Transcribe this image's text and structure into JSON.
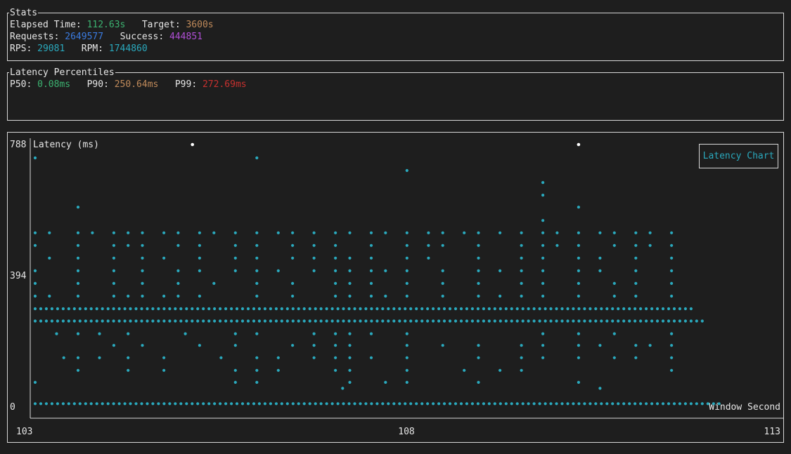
{
  "stats": {
    "title": "Stats",
    "elapsed_label": "Elapsed Time:",
    "elapsed_value": "112.63s",
    "target_label": "Target:",
    "target_value": "3600s",
    "requests_label": "Requests:",
    "requests_value": "2649577",
    "success_label": "Success:",
    "success_value": "444851",
    "rps_label": "RPS:",
    "rps_value": "29081",
    "rpm_label": "RPM:",
    "rpm_value": "1744860"
  },
  "latency": {
    "title": "Latency Percentiles",
    "p50_label": "P50:",
    "p50_value": "0.08ms",
    "p90_label": "P90:",
    "p90_value": "250.64ms",
    "p99_label": "P99:",
    "p99_value": "272.69ms"
  },
  "colors": {
    "point": "#2aa9bd",
    "point_highlight": "#ffffff",
    "axis": "#d8d8d8"
  },
  "chart_data": {
    "type": "scatter",
    "title": "Latency (ms)",
    "legend": "Latency Chart",
    "legend_position": "top-right",
    "xlabel": "Window Second",
    "ylabel": "",
    "y_ticks": [
      "788",
      "394",
      "0"
    ],
    "x_ticks": [
      "103",
      "108",
      "113"
    ],
    "xlim": [
      103,
      113
    ],
    "ylim": [
      0,
      788
    ],
    "dense_rows": [
      {
        "y": 10,
        "x_start": 103.0,
        "x_end": 112.6
      },
      {
        "y": 295,
        "x_start": 103.0,
        "x_end": 112.2
      },
      {
        "y": 258,
        "x_start": 103.0,
        "x_end": 112.4
      }
    ],
    "series": [
      {
        "name": "Latency Chart",
        "points": [
          [
            103.0,
            748
          ],
          [
            106.1,
            748
          ],
          [
            108.2,
            710
          ],
          [
            110.1,
            674
          ],
          [
            110.1,
            636
          ],
          [
            107.3,
            56
          ],
          [
            110.9,
            56
          ],
          [
            103.6,
            600
          ],
          [
            110.1,
            560
          ],
          [
            110.6,
            600
          ],
          [
            103.0,
            523
          ],
          [
            103.2,
            523
          ],
          [
            103.6,
            523
          ],
          [
            103.8,
            523
          ],
          [
            104.1,
            523
          ],
          [
            104.3,
            523
          ],
          [
            104.5,
            523
          ],
          [
            104.8,
            523
          ],
          [
            105.0,
            523
          ],
          [
            105.3,
            523
          ],
          [
            105.5,
            523
          ],
          [
            105.8,
            523
          ],
          [
            106.1,
            523
          ],
          [
            106.4,
            523
          ],
          [
            106.6,
            523
          ],
          [
            106.9,
            523
          ],
          [
            107.2,
            523
          ],
          [
            107.4,
            523
          ],
          [
            107.7,
            523
          ],
          [
            107.9,
            523
          ],
          [
            108.2,
            523
          ],
          [
            108.5,
            523
          ],
          [
            108.7,
            523
          ],
          [
            109.0,
            523
          ],
          [
            109.2,
            523
          ],
          [
            109.5,
            523
          ],
          [
            109.8,
            523
          ],
          [
            110.1,
            523
          ],
          [
            110.3,
            523
          ],
          [
            110.6,
            523
          ],
          [
            110.9,
            523
          ],
          [
            111.1,
            523
          ],
          [
            111.4,
            523
          ],
          [
            111.6,
            523
          ],
          [
            111.9,
            523
          ],
          [
            103.0,
            485
          ],
          [
            103.6,
            485
          ],
          [
            104.1,
            485
          ],
          [
            104.3,
            485
          ],
          [
            104.5,
            485
          ],
          [
            105.0,
            485
          ],
          [
            105.3,
            485
          ],
          [
            105.8,
            485
          ],
          [
            106.1,
            485
          ],
          [
            106.6,
            485
          ],
          [
            106.9,
            485
          ],
          [
            107.2,
            485
          ],
          [
            107.7,
            485
          ],
          [
            108.2,
            485
          ],
          [
            108.5,
            485
          ],
          [
            108.7,
            485
          ],
          [
            109.2,
            485
          ],
          [
            109.8,
            485
          ],
          [
            110.1,
            485
          ],
          [
            110.3,
            485
          ],
          [
            110.6,
            485
          ],
          [
            111.1,
            485
          ],
          [
            111.4,
            485
          ],
          [
            111.6,
            485
          ],
          [
            111.9,
            485
          ],
          [
            103.2,
            447
          ],
          [
            103.6,
            447
          ],
          [
            104.1,
            447
          ],
          [
            104.5,
            447
          ],
          [
            104.8,
            447
          ],
          [
            105.3,
            447
          ],
          [
            105.8,
            447
          ],
          [
            106.1,
            447
          ],
          [
            106.6,
            447
          ],
          [
            106.9,
            447
          ],
          [
            107.2,
            447
          ],
          [
            107.4,
            447
          ],
          [
            107.7,
            447
          ],
          [
            108.2,
            447
          ],
          [
            108.5,
            447
          ],
          [
            109.2,
            447
          ],
          [
            109.8,
            447
          ],
          [
            110.1,
            447
          ],
          [
            110.6,
            447
          ],
          [
            110.9,
            447
          ],
          [
            111.4,
            447
          ],
          [
            111.9,
            447
          ],
          [
            103.0,
            409
          ],
          [
            103.6,
            409
          ],
          [
            104.1,
            409
          ],
          [
            104.5,
            409
          ],
          [
            105.0,
            409
          ],
          [
            105.3,
            409
          ],
          [
            105.8,
            409
          ],
          [
            106.1,
            409
          ],
          [
            106.4,
            409
          ],
          [
            106.9,
            409
          ],
          [
            107.2,
            409
          ],
          [
            107.4,
            409
          ],
          [
            107.7,
            409
          ],
          [
            107.9,
            409
          ],
          [
            108.2,
            409
          ],
          [
            108.7,
            409
          ],
          [
            109.2,
            409
          ],
          [
            109.5,
            409
          ],
          [
            109.8,
            409
          ],
          [
            110.1,
            409
          ],
          [
            110.6,
            409
          ],
          [
            110.9,
            409
          ],
          [
            111.4,
            409
          ],
          [
            111.9,
            409
          ],
          [
            103.0,
            371
          ],
          [
            103.6,
            371
          ],
          [
            104.1,
            371
          ],
          [
            104.5,
            371
          ],
          [
            105.0,
            371
          ],
          [
            105.5,
            371
          ],
          [
            106.1,
            371
          ],
          [
            106.6,
            371
          ],
          [
            107.2,
            371
          ],
          [
            107.4,
            371
          ],
          [
            107.7,
            371
          ],
          [
            108.2,
            371
          ],
          [
            108.7,
            371
          ],
          [
            109.2,
            371
          ],
          [
            109.8,
            371
          ],
          [
            110.1,
            371
          ],
          [
            110.6,
            371
          ],
          [
            111.1,
            371
          ],
          [
            111.4,
            371
          ],
          [
            111.9,
            371
          ],
          [
            103.0,
            333
          ],
          [
            103.2,
            333
          ],
          [
            103.6,
            333
          ],
          [
            104.1,
            333
          ],
          [
            104.3,
            333
          ],
          [
            104.5,
            333
          ],
          [
            104.8,
            333
          ],
          [
            105.0,
            333
          ],
          [
            105.3,
            333
          ],
          [
            106.1,
            333
          ],
          [
            106.6,
            333
          ],
          [
            107.2,
            333
          ],
          [
            107.4,
            333
          ],
          [
            107.7,
            333
          ],
          [
            107.9,
            333
          ],
          [
            108.2,
            333
          ],
          [
            108.7,
            333
          ],
          [
            109.2,
            333
          ],
          [
            109.5,
            333
          ],
          [
            109.8,
            333
          ],
          [
            110.1,
            333
          ],
          [
            110.6,
            333
          ],
          [
            111.1,
            333
          ],
          [
            111.4,
            333
          ],
          [
            111.9,
            333
          ],
          [
            104.1,
            185
          ],
          [
            104.5,
            185
          ],
          [
            105.3,
            185
          ],
          [
            105.8,
            185
          ],
          [
            106.6,
            185
          ],
          [
            106.9,
            185
          ],
          [
            107.2,
            185
          ],
          [
            107.4,
            185
          ],
          [
            108.2,
            185
          ],
          [
            108.7,
            185
          ],
          [
            109.2,
            185
          ],
          [
            109.8,
            185
          ],
          [
            110.1,
            185
          ],
          [
            110.6,
            185
          ],
          [
            110.9,
            185
          ],
          [
            111.4,
            185
          ],
          [
            111.6,
            185
          ],
          [
            111.9,
            185
          ],
          [
            103.3,
            220
          ],
          [
            103.6,
            220
          ],
          [
            103.9,
            220
          ],
          [
            104.3,
            220
          ],
          [
            105.1,
            220
          ],
          [
            105.8,
            220
          ],
          [
            106.1,
            220
          ],
          [
            106.9,
            220
          ],
          [
            107.2,
            220
          ],
          [
            107.4,
            220
          ],
          [
            107.7,
            220
          ],
          [
            108.2,
            220
          ],
          [
            110.1,
            220
          ],
          [
            110.6,
            220
          ],
          [
            111.1,
            220
          ],
          [
            111.9,
            220
          ],
          [
            103.4,
            148
          ],
          [
            103.6,
            148
          ],
          [
            103.9,
            148
          ],
          [
            104.3,
            148
          ],
          [
            104.8,
            148
          ],
          [
            105.6,
            148
          ],
          [
            106.1,
            148
          ],
          [
            106.4,
            148
          ],
          [
            106.9,
            148
          ],
          [
            107.2,
            148
          ],
          [
            107.4,
            148
          ],
          [
            107.7,
            148
          ],
          [
            108.2,
            148
          ],
          [
            109.2,
            148
          ],
          [
            109.8,
            148
          ],
          [
            110.1,
            148
          ],
          [
            110.6,
            148
          ],
          [
            111.1,
            148
          ],
          [
            111.4,
            148
          ],
          [
            111.9,
            148
          ],
          [
            103.6,
            110
          ],
          [
            104.3,
            110
          ],
          [
            104.8,
            110
          ],
          [
            105.8,
            110
          ],
          [
            106.1,
            110
          ],
          [
            106.4,
            110
          ],
          [
            107.2,
            110
          ],
          [
            107.4,
            110
          ],
          [
            108.2,
            110
          ],
          [
            109.0,
            110
          ],
          [
            109.5,
            110
          ],
          [
            109.8,
            110
          ],
          [
            111.9,
            110
          ],
          [
            103.0,
            74
          ],
          [
            105.8,
            74
          ],
          [
            106.1,
            74
          ],
          [
            107.4,
            74
          ],
          [
            107.9,
            74
          ],
          [
            108.2,
            74
          ],
          [
            109.2,
            74
          ],
          [
            110.6,
            74
          ]
        ]
      }
    ],
    "highlight_points": [
      [
        105.2,
        788
      ],
      [
        110.6,
        788
      ]
    ]
  }
}
